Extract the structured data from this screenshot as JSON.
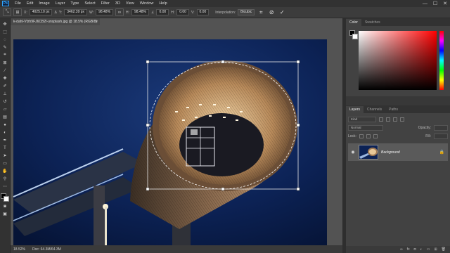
{
  "app": {
    "logo": "Ps"
  },
  "menu": [
    "File",
    "Edit",
    "Image",
    "Layer",
    "Type",
    "Select",
    "Filter",
    "3D",
    "View",
    "Window",
    "Help"
  ],
  "window_controls": {
    "minimize": "—",
    "maximize": "☐",
    "close": "✕"
  },
  "options_bar": {
    "x_label": "X:",
    "x_value": "4025.10 px",
    "y_label": "Y:",
    "y_value": "3462.39 px",
    "w_label": "W:",
    "w_value": "98.48%",
    "h_label": "H:",
    "h_value": "98.48%",
    "angle_value": "0.00",
    "hskew_label": "H:",
    "hskew_value": "0.00",
    "vskew_label": "V:",
    "vskew_value": "0.00",
    "interpolation_label": "Interpolation:",
    "interpolation_value": "Bicubic"
  },
  "document": {
    "tab_title": "k-dahl-Vfzh9FJ6CB2I-unsplash.jpg @ 18.5% (RGB/8)",
    "close": "×"
  },
  "status": {
    "zoom": "18.52%",
    "doc_info": "Doc: 64.3M/64.3M"
  },
  "right_panel": {
    "color_tabs": [
      "Color",
      "Swatches"
    ],
    "layers_tabs": [
      "Layers",
      "Channels",
      "Paths"
    ],
    "kind": "Kind",
    "blend_mode": "Normal",
    "opacity_label": "Opacity:",
    "lock_label": "Lock:",
    "fill_label": "Fill:",
    "layer_name": "Background",
    "footer_icons": [
      "link-icon",
      "fx-icon",
      "mask-icon",
      "adjust-icon",
      "folder-icon",
      "new-icon",
      "trash-icon"
    ]
  },
  "colors": {
    "accent": "#31a8ff",
    "sky": "#0a1f4a",
    "panel": "#424242"
  }
}
